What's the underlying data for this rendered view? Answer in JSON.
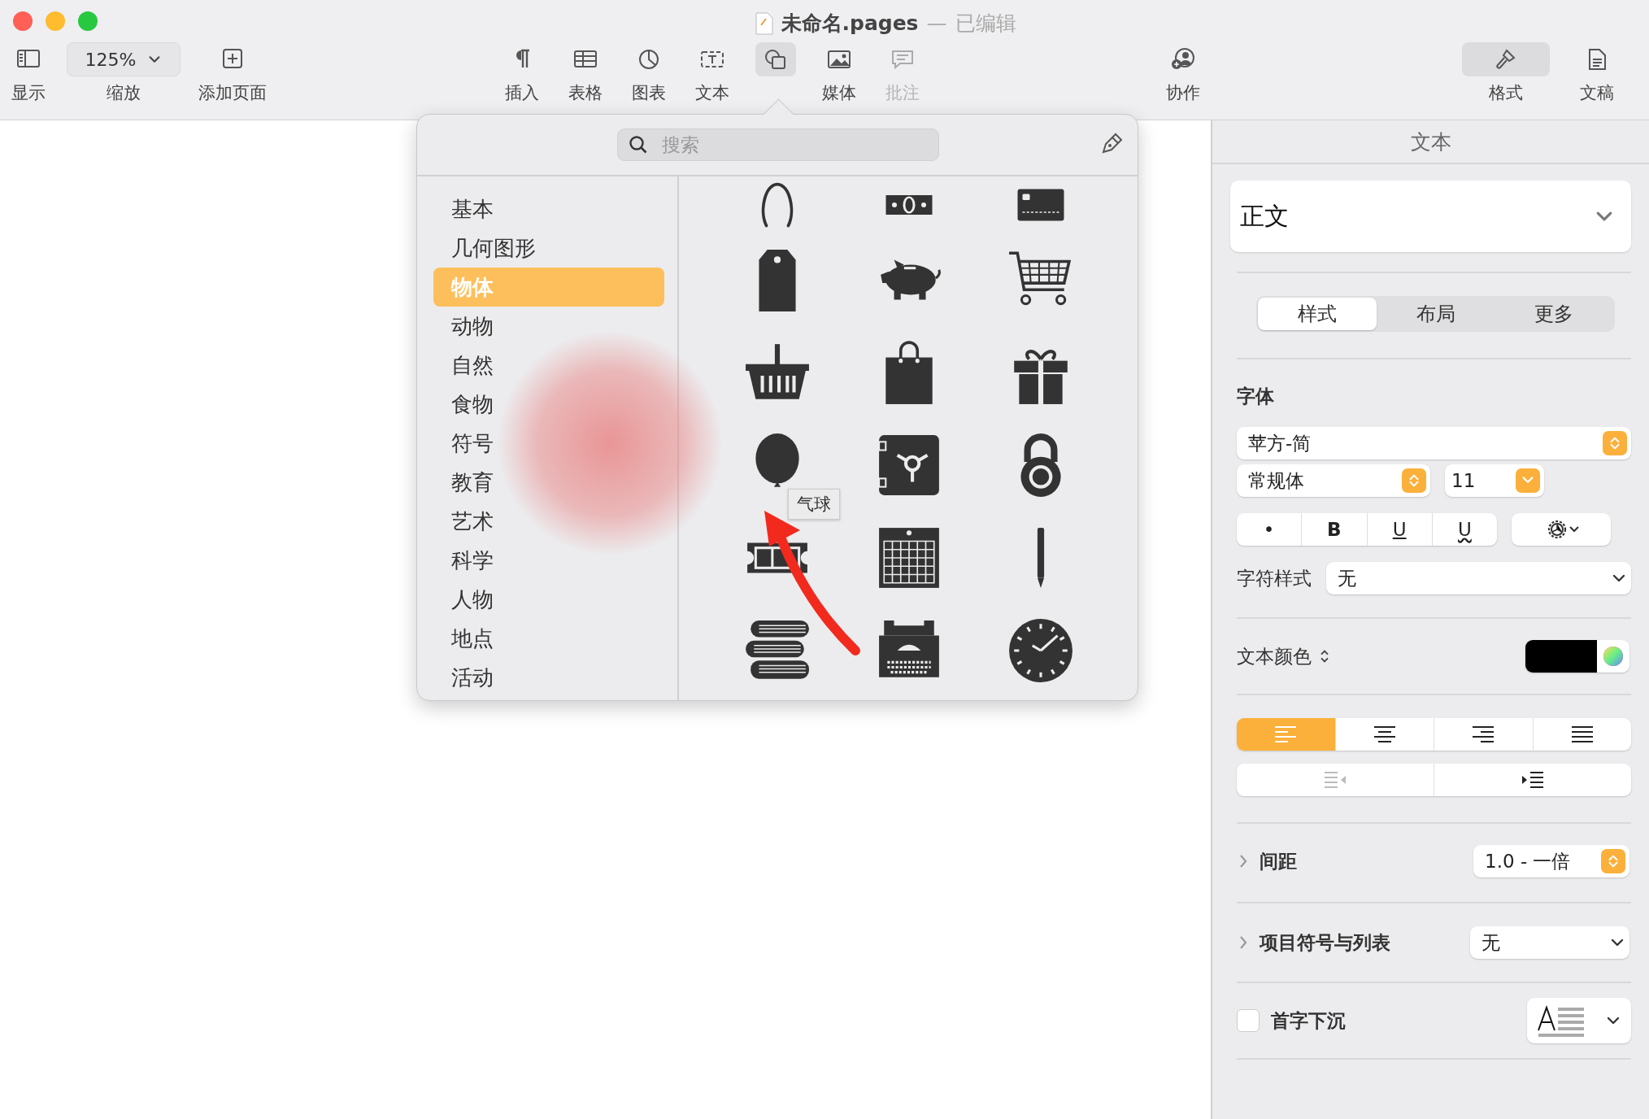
{
  "window": {
    "title": "未命名.pages",
    "separator": "—",
    "subtitle": "已编辑"
  },
  "toolbar": {
    "left": [
      {
        "kind": "sidebar",
        "label": "显示"
      },
      {
        "kind": "zoom",
        "value": "125%",
        "label": "缩放"
      },
      {
        "kind": "add-page",
        "label": "添加页面"
      }
    ],
    "insert": [
      {
        "kind": "paragraph",
        "label": "插入",
        "selected": false,
        "disabled": false
      },
      {
        "kind": "table",
        "label": "表格",
        "selected": false,
        "disabled": false
      },
      {
        "kind": "chart",
        "label": "图表",
        "selected": false,
        "disabled": false
      },
      {
        "kind": "text",
        "label": "文本",
        "selected": false,
        "disabled": false
      },
      {
        "kind": "shape",
        "selected": true,
        "disabled": false
      },
      {
        "kind": "media",
        "label": "媒体",
        "selected": false,
        "disabled": false
      },
      {
        "kind": "comment",
        "label": "批注",
        "selected": false,
        "disabled": true
      }
    ],
    "collaborate": {
      "label": "协作"
    },
    "right": [
      {
        "kind": "format",
        "label": "格式",
        "selected": true
      },
      {
        "kind": "document",
        "label": "文稿",
        "selected": false
      }
    ]
  },
  "shape_library": {
    "search": {
      "placeholder": "搜索"
    },
    "categories": [
      {
        "label": "基本",
        "selected": false
      },
      {
        "label": "几何图形",
        "selected": false
      },
      {
        "label": "物体",
        "selected": true
      },
      {
        "label": "动物",
        "selected": false
      },
      {
        "label": "自然",
        "selected": false
      },
      {
        "label": "食物",
        "selected": false
      },
      {
        "label": "符号",
        "selected": false
      },
      {
        "label": "教育",
        "selected": false
      },
      {
        "label": "艺术",
        "selected": false
      },
      {
        "label": "科学",
        "selected": false
      },
      {
        "label": "人物",
        "selected": false
      },
      {
        "label": "地点",
        "selected": false
      },
      {
        "label": "活动",
        "selected": false
      }
    ],
    "shapes": [
      {
        "kind": "wishbone"
      },
      {
        "kind": "bill"
      },
      {
        "kind": "card"
      },
      {
        "kind": "tag"
      },
      {
        "kind": "piggy"
      },
      {
        "kind": "cart"
      },
      {
        "kind": "basket"
      },
      {
        "kind": "bag"
      },
      {
        "kind": "gift"
      },
      {
        "kind": "balloon"
      },
      {
        "kind": "safe"
      },
      {
        "kind": "padlock"
      },
      {
        "kind": "ticket"
      },
      {
        "kind": "calendar"
      },
      {
        "kind": "pencil"
      },
      {
        "kind": "books"
      },
      {
        "kind": "typewriter"
      },
      {
        "kind": "clock"
      }
    ],
    "tooltip": "气球"
  },
  "inspector": {
    "title": "文本",
    "paragraph_style": "正文",
    "tabs": [
      {
        "label": "样式",
        "selected": true
      },
      {
        "label": "布局",
        "selected": false
      },
      {
        "label": "更多",
        "selected": false
      }
    ],
    "font": {
      "heading": "字体",
      "family": "苹方-简",
      "typeface": "常规体",
      "size": "11",
      "styles": [
        {
          "kind": "dot",
          "label": "•"
        },
        {
          "kind": "bold",
          "label": "B"
        },
        {
          "kind": "underline",
          "label": "U"
        },
        {
          "kind": "wavy",
          "label": "U"
        }
      ]
    },
    "character_style": {
      "label": "字符样式",
      "value": "无"
    },
    "text_color": {
      "label": "文本颜色",
      "color": "#000000"
    },
    "alignment": [
      {
        "kind": "left",
        "selected": true
      },
      {
        "kind": "center",
        "selected": false
      },
      {
        "kind": "right",
        "selected": false
      },
      {
        "kind": "justify",
        "selected": false
      }
    ],
    "indent": [
      {
        "kind": "decrease",
        "disabled": true
      },
      {
        "kind": "increase",
        "disabled": false
      }
    ],
    "spacing": {
      "label": "间距",
      "value": "1.0 - 一倍",
      "expanded": false
    },
    "bullets": {
      "label": "项目符号与列表",
      "value": "无",
      "expanded": false
    },
    "drop_cap": {
      "label": "首字下沉",
      "checked": false
    }
  }
}
